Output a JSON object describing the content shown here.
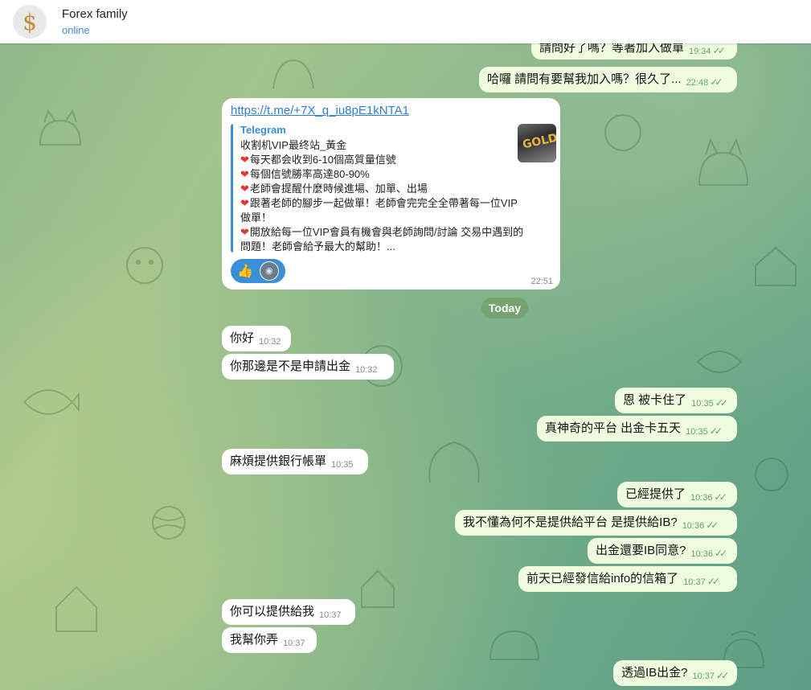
{
  "header": {
    "avatar_symbol": "$",
    "title": "Forex family",
    "status": "online"
  },
  "date_separator": "Today",
  "link_message": {
    "url": "https://t.me/+7X_q_iu8pE1kNTA1",
    "site": "Telegram",
    "thumb_text": "GOLD",
    "lines": [
      "收割机VIP最终站_黃金",
      "每天都会收到6-10個高質量信號",
      "每個信號勝率高達80-90%",
      "老師會提醒什麼時候進場、加單、出場",
      "跟著老師的腳步一起做單！老師會完完全全帶著每一位VIP",
      "做單！",
      "開放給每一位VIP會員有機會與老師詢問/討論 交易中遇到的",
      "問題！老師會給予最大的幫助！..."
    ],
    "reaction_emoji": "👍",
    "time": "22:51"
  },
  "messages": [
    {
      "id": "m1",
      "text": "請問好了嗎？等著加入做單",
      "time": "19:34",
      "out": true
    },
    {
      "id": "m2",
      "text": "哈囉 請問有要幫我加入嗎？很久了...",
      "time": "22:48",
      "out": true
    },
    {
      "id": "m3",
      "text": "你好",
      "time": "10:32",
      "out": false
    },
    {
      "id": "m4",
      "text": "你那邊是不是申請出金",
      "time": "10:32",
      "out": false
    },
    {
      "id": "m5",
      "text": "恩 被卡住了",
      "time": "10:35",
      "out": true
    },
    {
      "id": "m6",
      "text": "真神奇的平台 出金卡五天",
      "time": "10:35",
      "out": true
    },
    {
      "id": "m7",
      "text": "麻煩提供銀行帳單",
      "time": "10:35",
      "out": false
    },
    {
      "id": "m8",
      "text": "已經提供了",
      "time": "10:36",
      "out": true
    },
    {
      "id": "m9",
      "text": "我不懂為何不是提供給平台 是提供給IB?",
      "time": "10:36",
      "out": true
    },
    {
      "id": "m10",
      "text": "出金還要IB同意?",
      "time": "10:36",
      "out": true
    },
    {
      "id": "m11",
      "text": "前天已經發信給info的信箱了",
      "time": "10:37",
      "out": true
    },
    {
      "id": "m12",
      "text": "你可以提供給我",
      "time": "10:37",
      "out": false
    },
    {
      "id": "m13",
      "text": "我幫你弄",
      "time": "10:37",
      "out": false
    },
    {
      "id": "m14",
      "text": "透過IB出金?",
      "time": "10:37",
      "out": true
    }
  ],
  "colors": {
    "accent": "#3a8fd6",
    "outgoing_bubble": "#effdde",
    "incoming_bubble": "#ffffff",
    "check": "#5fa761"
  }
}
